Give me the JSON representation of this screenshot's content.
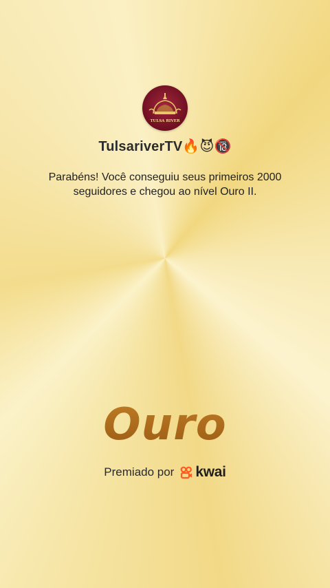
{
  "profile": {
    "username": "TulsariverTV🔥😈🔞",
    "avatar_text": "TULSA RIVER"
  },
  "message": "Parabéns! Você conseguiu seus primeiros 2000 seguidores e chegou ao nível Ouro II.",
  "level": {
    "title": "Ouro"
  },
  "awarded": {
    "label": "Premiado por",
    "brand": "kwai",
    "brand_color": "#ff5a1f"
  },
  "colors": {
    "background": "#f6e6a8",
    "level_text": "#a0661b",
    "avatar": "#7a1226"
  }
}
